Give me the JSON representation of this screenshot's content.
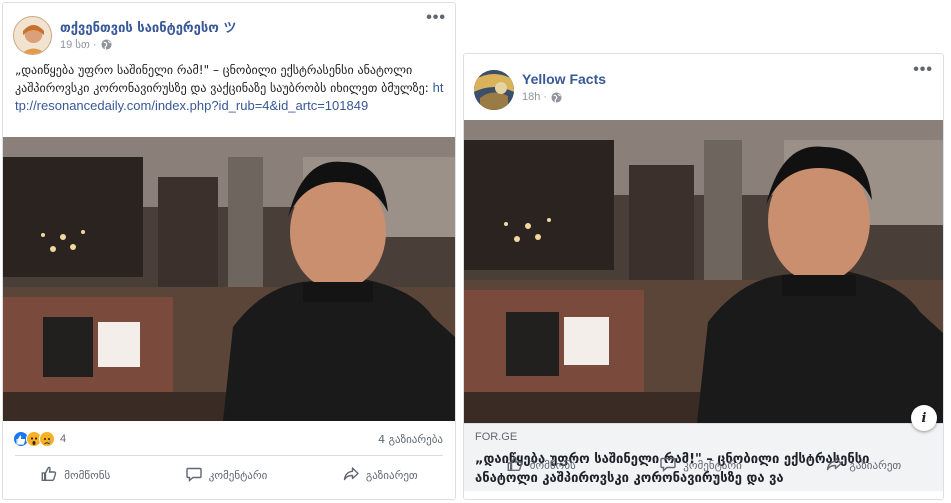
{
  "posts": [
    {
      "author": "თქვენთვის საინტერესო ツ",
      "time": "19 სთ ·",
      "text": "„დაიწყება უფრო საშინელი რამ!\" – ცნობილი ექსტრასენსი ანატოლი კაშპიროვსკი კორონავირუსზე და ვაქცინაზე საუბრობს",
      "read_prefix": "იხილეთ ბმულზე:",
      "link": "http://resonancedaily.com/index.php?id_rub=4&id_artc=101849",
      "reaction_count": "4",
      "shares": "4 გაზიარება",
      "actions": {
        "like": "მომწონს",
        "comment": "კომენტარი",
        "share": "გაზიარეთ"
      }
    },
    {
      "author": "Yellow Facts",
      "time": "18h ·",
      "preview_domain": "FOR.GE",
      "preview_title": "„დაიწყება უფრო საშინელი რამ!\" – ცნობილი ექსტრასენსი ანატოლი კაშპიროვსკი კორონავირუსზე და ვა",
      "info_label": "i",
      "actions": {
        "like": "მომწონს",
        "comment": "კომენტარი",
        "share": "გაზიარეთ"
      }
    }
  ],
  "more_label": "•••",
  "colors": {
    "link": "#385898",
    "meta": "#90949c",
    "like": "#1877f2",
    "wow": "#f7b125"
  },
  "icons": [
    "globe-icon",
    "thumbs-up-icon",
    "comment-icon",
    "share-icon",
    "info-icon",
    "more-icon",
    "like-reaction-icon",
    "wow-reaction-icon",
    "sad-reaction-icon"
  ]
}
